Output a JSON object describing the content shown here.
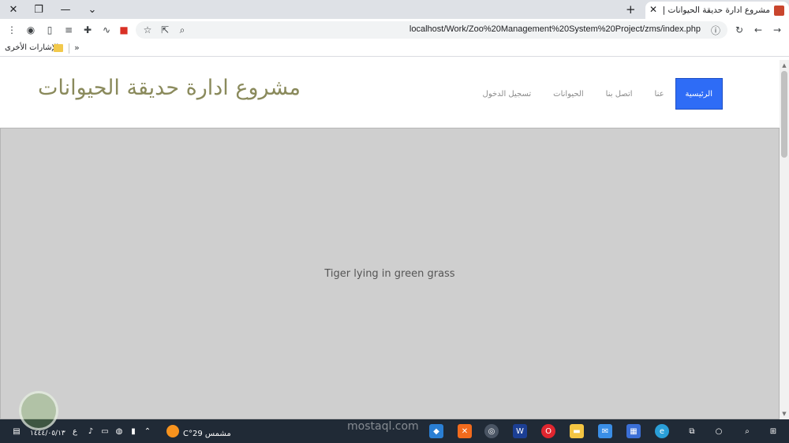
{
  "browser": {
    "tab_title": "مشروع ادارة حديقة الحيوانات | الص",
    "new_tab": "+",
    "close_tab": "✕",
    "url": "localhost/Work/Zoo%20Management%20System%20Project/zms/index.php",
    "bookmarks_folder": "الإشارات الأخرى",
    "bookmarks_overflow": "»"
  },
  "site": {
    "title": "مشروع ادارة حديقة الحيوانات",
    "nav": [
      {
        "label": "الرئيسية",
        "active": true
      },
      {
        "label": "عنا",
        "active": false
      },
      {
        "label": "اتصل بنا",
        "active": false
      },
      {
        "label": "الحيوانات",
        "active": false
      },
      {
        "label": "تسجيل الدخول",
        "active": false
      }
    ],
    "hero_image_label": "Tiger lying in green grass"
  },
  "taskbar": {
    "date": "١٤٤٤/٠٥/١٣",
    "keyboard": "ع",
    "weather": "مشمس  29°C"
  },
  "watermark": "mostaql.com"
}
